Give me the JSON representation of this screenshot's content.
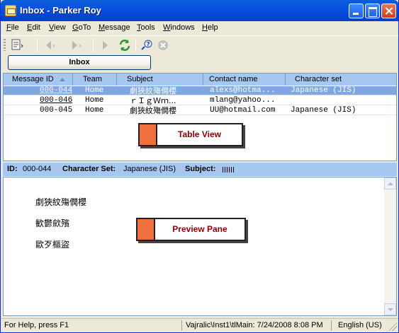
{
  "window": {
    "title": "Inbox - Parker Roy"
  },
  "menu": [
    "File",
    "Edit",
    "View",
    "GoTo",
    "Message",
    "Tools",
    "Windows",
    "Help"
  ],
  "menu_underline": [
    "F",
    "E",
    "V",
    "G",
    "M",
    "T",
    "W",
    "H"
  ],
  "menu_rest": [
    "ile",
    "dit",
    "iew",
    "oTo",
    "essage",
    "ools",
    "indows",
    "elp"
  ],
  "toolbar": {
    "icons": [
      "new-message-icon",
      "back-icon",
      "forward-icon",
      "next-icon",
      "refresh-icon",
      "help-icon",
      "stop-icon"
    ]
  },
  "folder": {
    "label": "Inbox"
  },
  "table": {
    "columns": [
      "Message ID",
      "Team",
      "Subject",
      "Contact name",
      "Character set"
    ],
    "rows": [
      {
        "id": "000-044",
        "team": "Home",
        "subject": "劇狹紋殤僩櫻",
        "contact": "alexs@hotma...",
        "charset": "Japanese (JIS)"
      },
      {
        "id": "000-046",
        "team": "Home",
        "subject": "ｒＩｇＷｍ...",
        "contact": "mlang@yahoo...",
        "charset": ""
      },
      {
        "id": "000-045",
        "team": "Home",
        "subject": "劇狹紋殤僩櫻",
        "contact": "UU@hotmail.com",
        "charset": "Japanese (JIS)"
      }
    ],
    "callout": "Table View"
  },
  "info": {
    "id_label": "ID:",
    "id_value": "000-044",
    "charset_label": "Character Set:",
    "charset_value": "Japanese (JIS)",
    "subject_label": "Subject:"
  },
  "preview": {
    "lines": [
      "劇狹紋殤僩櫻",
      "歓鬱歛殯",
      "歐歹樞盜"
    ],
    "callout": "Preview Pane"
  },
  "status": {
    "help": "For Help, press F1",
    "path": "Vajralic\\Inst1\\tlMain: 7/24/2008 8:08 PM",
    "locale": "English (US)"
  },
  "colors": {
    "title_bar": "#0b4fe0",
    "header_bg": "#a6c8f0",
    "selection": "#7fa8e0",
    "callout_accent": "#f07040",
    "callout_text": "#8b0000"
  }
}
